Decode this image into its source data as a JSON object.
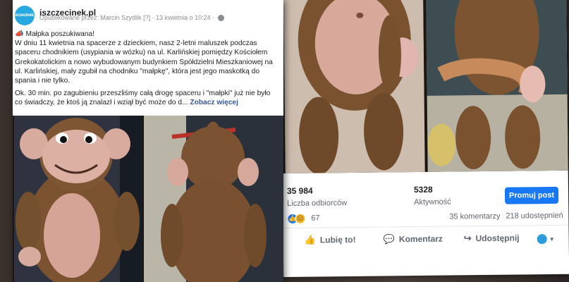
{
  "post": {
    "page_name": "iszczecinek.pl",
    "avatar_text": "iSzczecinek.pl",
    "meta": {
      "published_by": "Opublikowane przez: Marcin Szydlik",
      "suffix": "[?]",
      "separator": "·",
      "date": "13 kwietnia o 10:24",
      "separator2": "·"
    },
    "headline_icon": "📣",
    "headline": "Małpka poszukiwana!",
    "paragraph1": "W dniu 11 kwietnia na spacerze z dzieckiem, nasz 2-letni maluszek podczas spaceru chodnikiem (usypiania w wózku) na ul. Karlińskiej pomiędzy Kościołem Grekokatolickim a nowo wybudowanym budynkiem Spółdzielni Mieszkaniowej na ul. Karlińskiej, mały zgubił na chodniku \"małpkę\", która jest jego maskotką do spania i nie tylko.",
    "paragraph2": "Ok. 30 min. po zagubieniu przeszliśmy całą drogę spaceru i \"małpki\" już nie było co świadczy, że ktoś ją znalazł i wziął być może do d...",
    "see_more": "Zobacz więcej"
  },
  "insights": {
    "reach_value": "35 984",
    "reach_label": "Liczba odbiorców",
    "engagement_value": "5328",
    "engagement_label": "Aktywność",
    "promote_label": "Promuj post"
  },
  "reactions": {
    "icons": [
      "like-icon",
      "sad-icon"
    ],
    "count": "67",
    "comments": "35 komentarzy",
    "shares": "218 udostępnień"
  },
  "actions": {
    "like": "Lubię to!",
    "comment": "Komentarz",
    "share": "Udostępnij"
  },
  "colors": {
    "accent": "#1877f2",
    "link": "#385898",
    "page_avatar": "#28a8e0"
  }
}
